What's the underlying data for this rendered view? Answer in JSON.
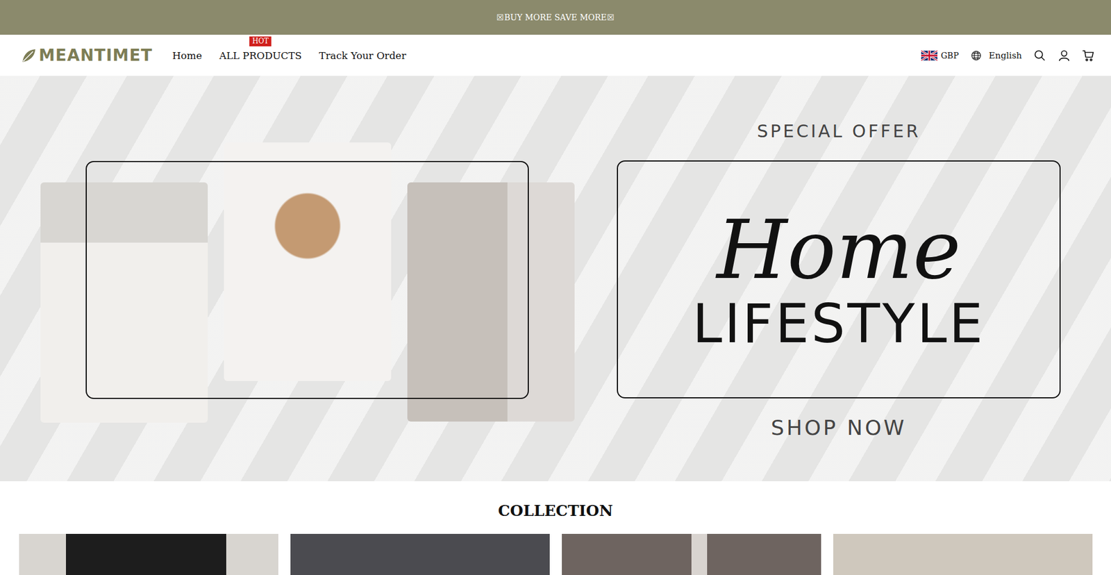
{
  "announcement": {
    "text": "☒BUY MORE SAVE MORE☒"
  },
  "header": {
    "logo": "MEANTIMET",
    "nav": [
      {
        "label": "Home"
      },
      {
        "label": "ALL PRODUCTS",
        "badge": "HOT"
      },
      {
        "label": "Track Your Order"
      }
    ],
    "currency": "GBP",
    "language": "English"
  },
  "hero": {
    "eyebrow": "SPECIAL OFFER",
    "script": "Home",
    "title": "LIFESTYLE",
    "cta": "SHOP NOW"
  },
  "collection": {
    "title": "COLLECTION",
    "cards": [
      {},
      {},
      {},
      {}
    ]
  }
}
